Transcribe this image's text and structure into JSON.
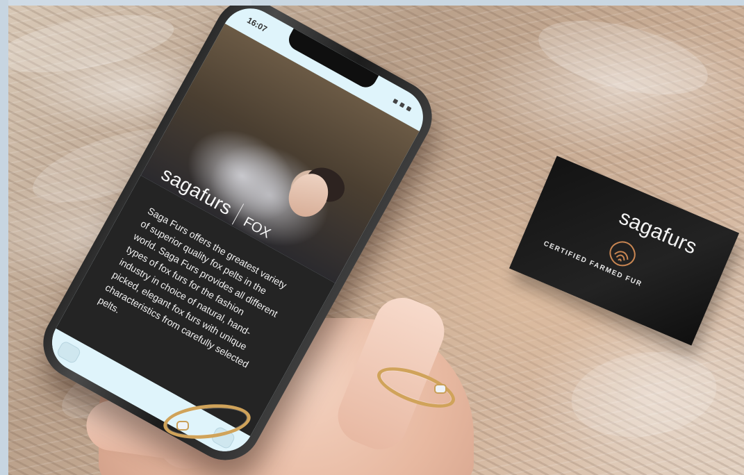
{
  "phone": {
    "status_time": "16:07",
    "brand_logo": "sagafurs",
    "brand_category": "FOX",
    "body_copy": "Saga Furs offers the greatest variety of superior quality fox pelts in the world. Saga Furs provides all different types of fox furs for the fashion industry in choice of natural, hand-picked, elegant fox furs with unique characteristics from carefully selected pelts."
  },
  "label": {
    "brand_logo": "sagafurs",
    "certified_text": "CERTIFIED FARMED FUR"
  },
  "colors": {
    "screen_background": "#dff4fb",
    "panel_background": "#242424",
    "label_background": "#131313",
    "ring_gold": "#d0a35a"
  },
  "icons": {
    "emblem": "saga-emblem-icon"
  }
}
